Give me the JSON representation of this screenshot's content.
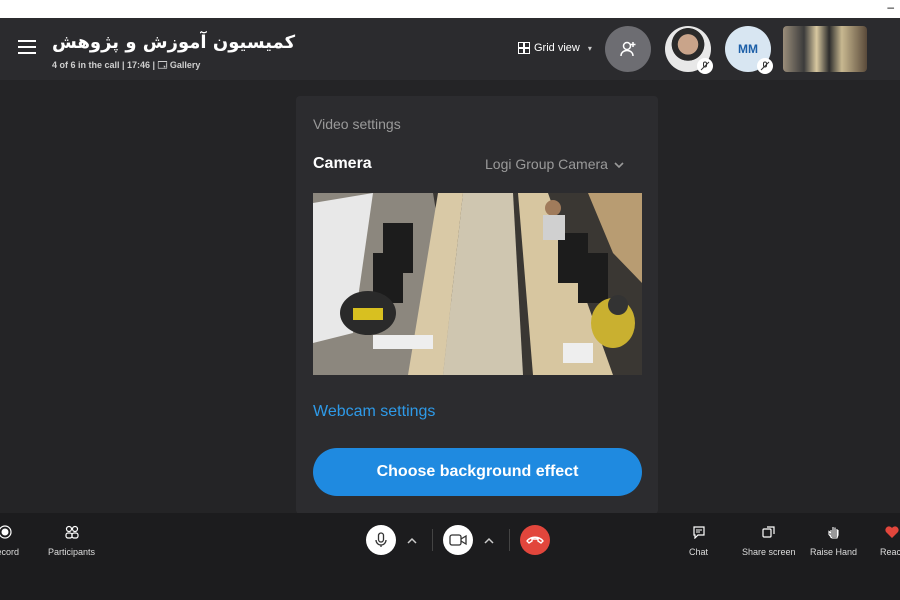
{
  "window": {
    "minimize_label": "–"
  },
  "header": {
    "title": "کمیسیون آموزش و پژوهش",
    "subtitle": "4 of 6 in the call | 17:46 | 🗔 Gallery",
    "view_label": "Grid view",
    "participants": [
      {
        "initials": "",
        "muted": true
      },
      {
        "initials": "MM",
        "muted": true
      }
    ]
  },
  "video_settings": {
    "title": "Video settings",
    "camera_label": "Camera",
    "camera_value": "Logi Group Camera",
    "webcam_link": "Webcam settings",
    "background_button": "Choose background effect"
  },
  "toolbar": {
    "record": "Record",
    "participants": "Participants",
    "chat": "Chat",
    "share_screen": "Share screen",
    "raise_hand": "Raise Hand",
    "react": "React"
  },
  "colors": {
    "accent": "#1f8ae0",
    "end_call": "#e2463c",
    "background": "#202124"
  }
}
